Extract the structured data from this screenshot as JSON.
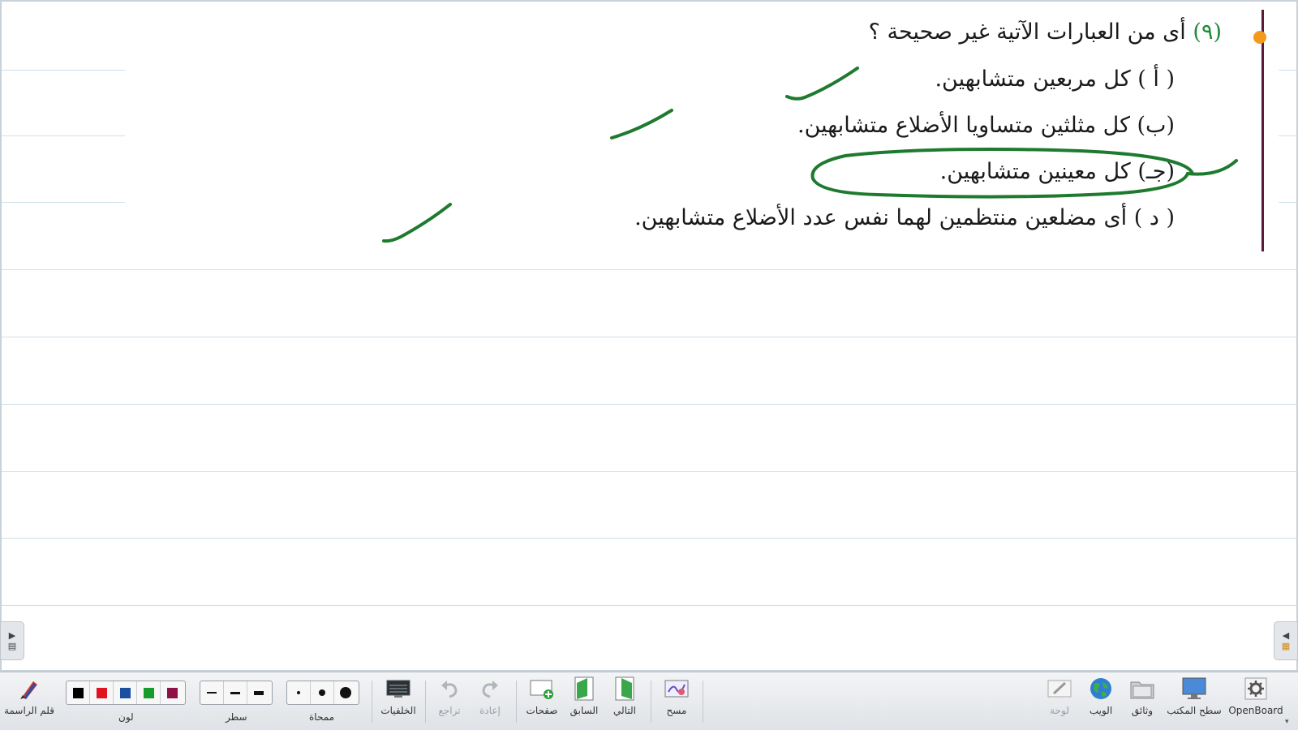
{
  "board": {
    "question": {
      "number": "(٩)",
      "text": "أى من العبارات الآتية غير صحيحة ؟"
    },
    "options": [
      {
        "id": "a",
        "text": "( أ ) كل مربعين متشابهين."
      },
      {
        "id": "b",
        "text": "(ب) كل مثلثين متساويا الأضلاع متشابهين."
      },
      {
        "id": "c",
        "text": "(جـ) كل معينين متشابهين."
      },
      {
        "id": "d",
        "text": "( د ) أى مضلعين منتظمين لهما نفس عدد الأضلاع متشابهين."
      }
    ],
    "ink_color": "#1e7a2e",
    "accent_colors": {
      "bullet": "#f39a1c",
      "margin_line": "#5a1a3a",
      "question_number": "#1f8a3a"
    }
  },
  "toolbar": {
    "pen_label": "قلم الراسمة",
    "color_label": "لون",
    "colors": [
      "#000000",
      "#e0141e",
      "#1a4fa0",
      "#169c2c",
      "#8e1046"
    ],
    "line_label": "سطر",
    "eraser_label": "ممحاة",
    "backgrounds_label": "الخلفيات",
    "undo_label": "تراجع",
    "redo_label": "إعادة",
    "pages_label": "صفحات",
    "previous_label": "السابق",
    "next_label": "التالي",
    "clear_label": "مسح",
    "board_label": "لوحة",
    "web_label": "الويب",
    "documents_label": "وثائق",
    "desktop_label": "سطح المكتب",
    "app_label": "OpenBoard"
  }
}
